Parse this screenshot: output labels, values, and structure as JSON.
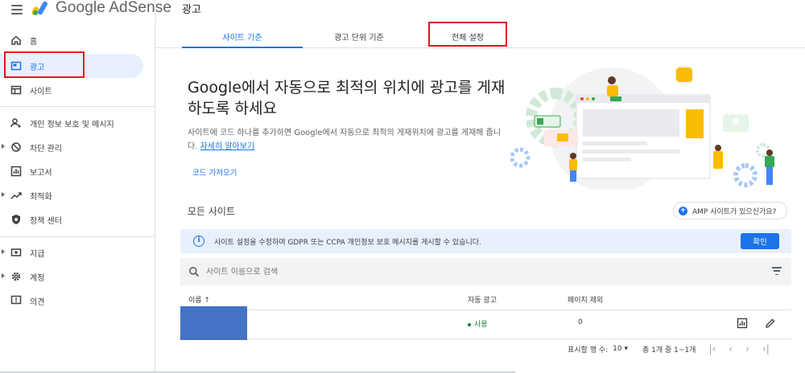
{
  "header": {
    "app_name": "Google AdSense",
    "page_title": "광고"
  },
  "sidebar": {
    "items": [
      {
        "label": "홈",
        "icon": "home-icon"
      },
      {
        "label": "광고",
        "icon": "ads-icon",
        "active": true
      },
      {
        "label": "사이트",
        "icon": "sites-icon"
      },
      {
        "label": "개인 정보 보호 및 메시지",
        "icon": "privacy-icon"
      },
      {
        "label": "차단 관리",
        "icon": "block-icon"
      },
      {
        "label": "보고서",
        "icon": "reports-icon"
      },
      {
        "label": "최적화",
        "icon": "optimize-icon"
      },
      {
        "label": "정책 센터",
        "icon": "policy-icon"
      },
      {
        "label": "지급",
        "icon": "payments-icon"
      },
      {
        "label": "계정",
        "icon": "gear-icon"
      },
      {
        "label": "의견",
        "icon": "feedback-icon"
      }
    ]
  },
  "tabs": [
    {
      "label": "사이트 기준",
      "active": true
    },
    {
      "label": "광고 단위 기준"
    },
    {
      "label": "전체 설정"
    }
  ],
  "hero": {
    "title": "Google에서 자동으로 최적의 위치에 광고를 게재하도록 하세요",
    "desc": "사이트에 코드 하나를 추가하면 Google에서 자동으로 최적의 게재위치에 광고를 게재해 줍니다.",
    "learn_more": "자세히 알아보기",
    "get_code": "코드 가져오기"
  },
  "sites": {
    "title": "모든 사이트",
    "amp_button": "AMP 사이트가 있으신가요?",
    "banner_text": "사이트 설정을 수정하여 GDPR 또는 CCPA 개인정보 보호 메시지를 게시할 수 있습니다.",
    "banner_button": "확인",
    "search_placeholder": "사이트 이름으로 검색",
    "columns": {
      "name": "이름 ↑",
      "auto_ads": "자동 광고",
      "excluded": "페이지 제외"
    },
    "rows": [
      {
        "status": "사용",
        "excluded": "0"
      }
    ],
    "pager": {
      "rows_label": "표시할 행 수:",
      "rows_value": "10",
      "range": "총 1개 중 1~1개"
    }
  },
  "colors": {
    "accent": "#1a73e8",
    "active_bg": "#e8f0fe",
    "highlight_box": "#e0141f",
    "status_green": "#188038"
  }
}
